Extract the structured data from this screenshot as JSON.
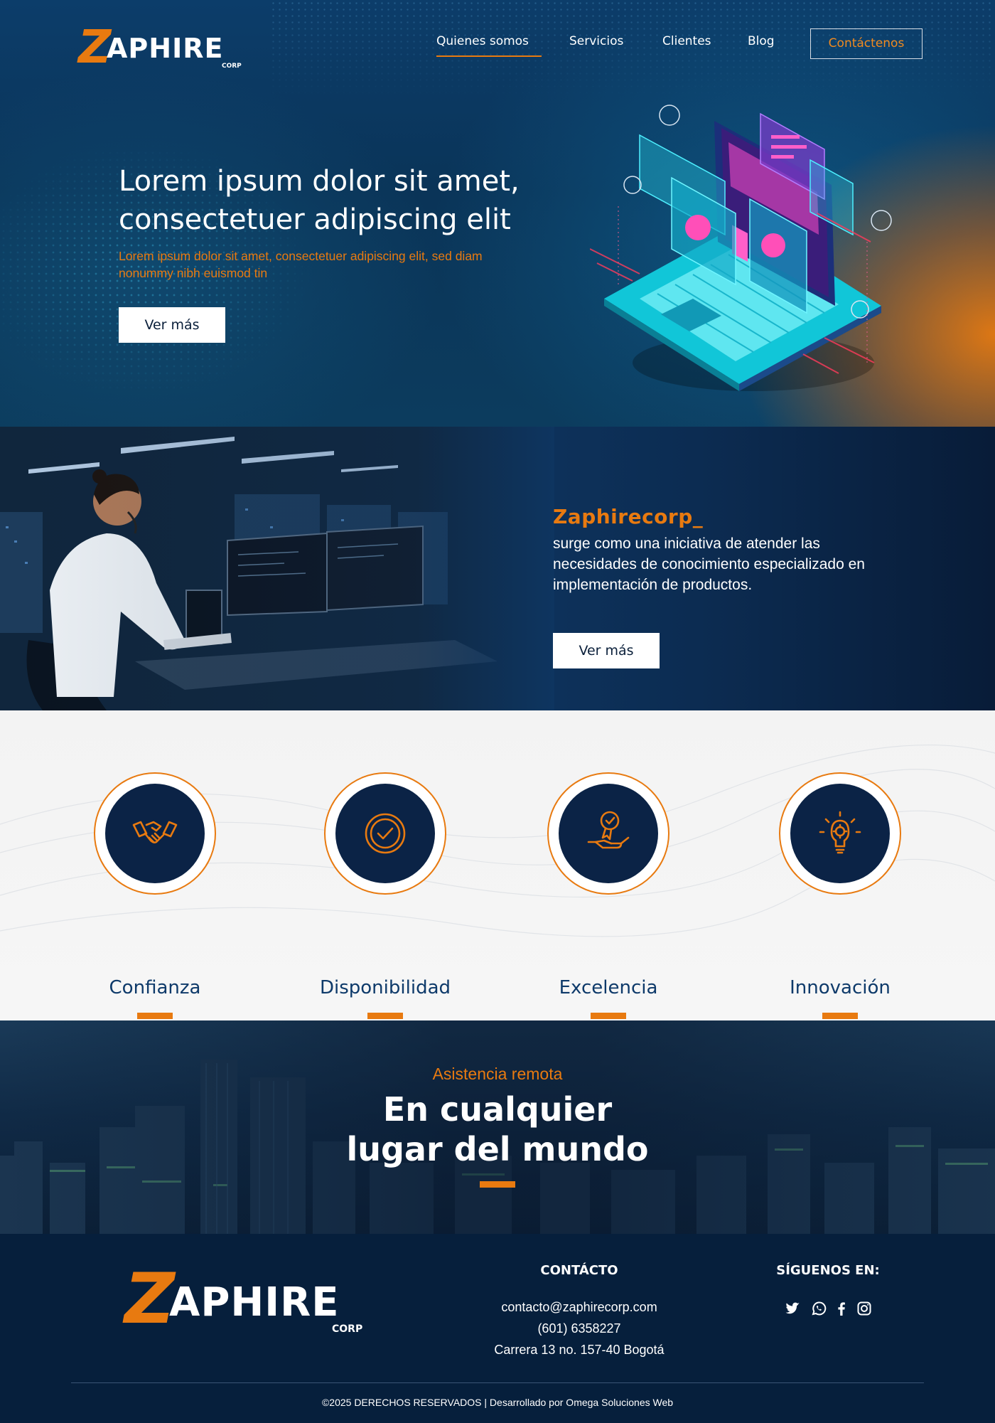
{
  "brand": {
    "logo_letter": "Z",
    "logo_word": "APHIRE",
    "logo_corp": "CORP"
  },
  "nav": {
    "items": [
      "Quienes somos",
      "Servicios",
      "Clientes",
      "Blog"
    ],
    "active": "Quienes somos",
    "cta": "Contáctenos"
  },
  "hero": {
    "title_line1": "Lorem ipsum dolor sit amet,",
    "title_line2": "consectetuer adipiscing elit",
    "subtitle": "Lorem ipsum dolor sit amet, consectetuer adipiscing elit, sed diam nonummy nibh euismod tin",
    "button": "Ver más"
  },
  "about": {
    "title": "Zaphirecorp_",
    "text": "surge como una iniciativa de atender las necesidades de conocimiento especializado en implementación de productos.",
    "button": "Ver más"
  },
  "values": [
    {
      "label": "Confianza",
      "icon": "handshake-icon"
    },
    {
      "label": "Disponibilidad",
      "icon": "check-circle-icon"
    },
    {
      "label": "Excelencia",
      "icon": "award-hand-icon"
    },
    {
      "label": "Innovación",
      "icon": "lightbulb-gear-icon"
    }
  ],
  "remote": {
    "kicker": "Asistencia remota",
    "title_line1": "En cualquier",
    "title_line2": "lugar del mundo"
  },
  "footer": {
    "contact_title": "CONTÁCTO",
    "email": "contacto@zaphirecorp.com",
    "phone": "(601) 6358227",
    "address": "Carrera 13 no. 157-40 Bogotá",
    "follow_title": "SÍGUENOS EN:",
    "social": [
      "twitter-icon",
      "whatsapp-icon",
      "facebook-icon",
      "instagram-icon"
    ],
    "copyright": "©2025 DERECHOS RESERVADOS | Desarrollado por Omega Soluciones Web"
  },
  "colors": {
    "accent": "#e87a10",
    "navy": "#0b2346",
    "footer_bg": "#061f3c",
    "value_text": "#0e3a6a"
  }
}
